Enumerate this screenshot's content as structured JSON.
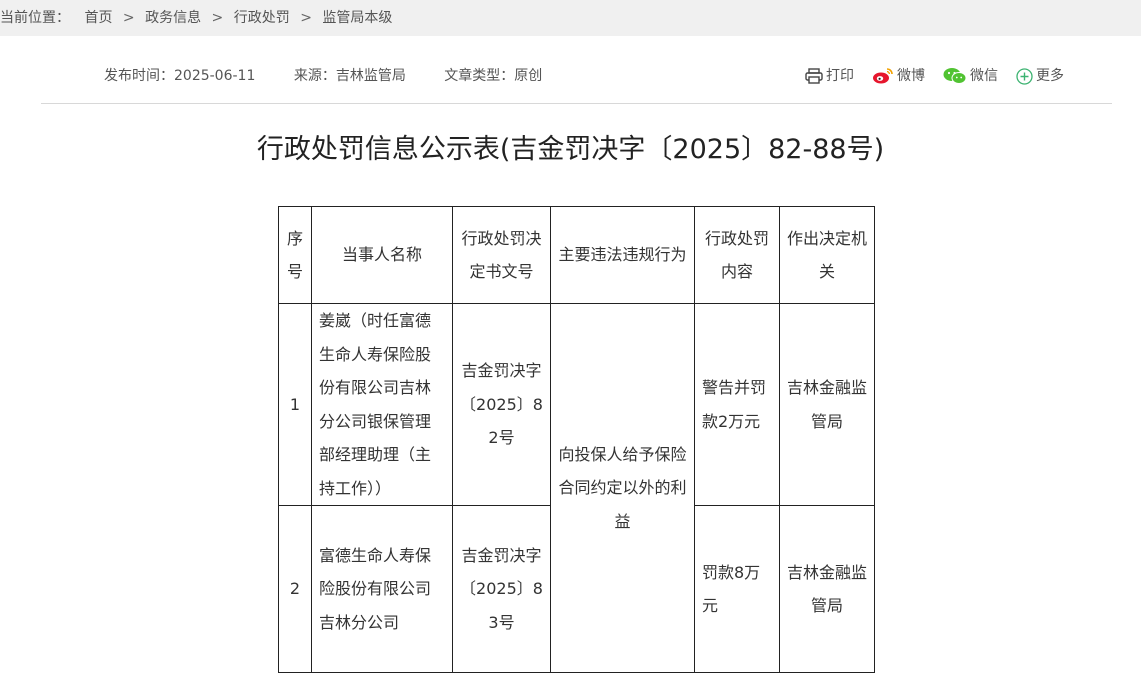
{
  "breadcrumb": {
    "label": "当前位置：",
    "items": [
      "首页",
      "政务信息",
      "行政处罚",
      "监管局本级"
    ],
    "separator": ">"
  },
  "meta": {
    "publish_time": "发布时间：2025-06-11",
    "source": "来源：吉林监管局",
    "doc_type": "文章类型：原创"
  },
  "share": {
    "print": "打印",
    "weibo": "微博",
    "wechat": "微信",
    "more": "更多"
  },
  "title": "行政处罚信息公示表(吉金罚决字〔2025〕82-88号)",
  "table": {
    "headers": {
      "seq": "序号",
      "party": "当事人名称",
      "doc_no": "行政处罚决定书文号",
      "violation": "主要违法违规行为",
      "penalty": "行政处罚内容",
      "authority": "作出决定机关"
    },
    "rows": [
      {
        "seq": "1",
        "party": "姜崴（时任富德生命人寿保险股份有限公司吉林分公司银保管理部经理助理（主持工作））",
        "doc_no": "吉金罚决字〔2025〕82号",
        "penalty": "警告并罚款2万元",
        "authority": "吉林金融监管局"
      },
      {
        "seq": "2",
        "party": "富德生命人寿保险股份有限公司吉林分公司",
        "doc_no": "吉金罚决字〔2025〕83号",
        "penalty": "罚款8万元",
        "authority": "吉林金融监管局"
      }
    ],
    "shared_violation": "向投保人给予保险合同约定以外的利益"
  },
  "colors": {
    "breadcrumb_bg": "#f0f0f0",
    "table_border": "#222222",
    "weibo_red": "#e6162d",
    "wechat_green": "#51c332",
    "more_green": "#3cb371"
  }
}
